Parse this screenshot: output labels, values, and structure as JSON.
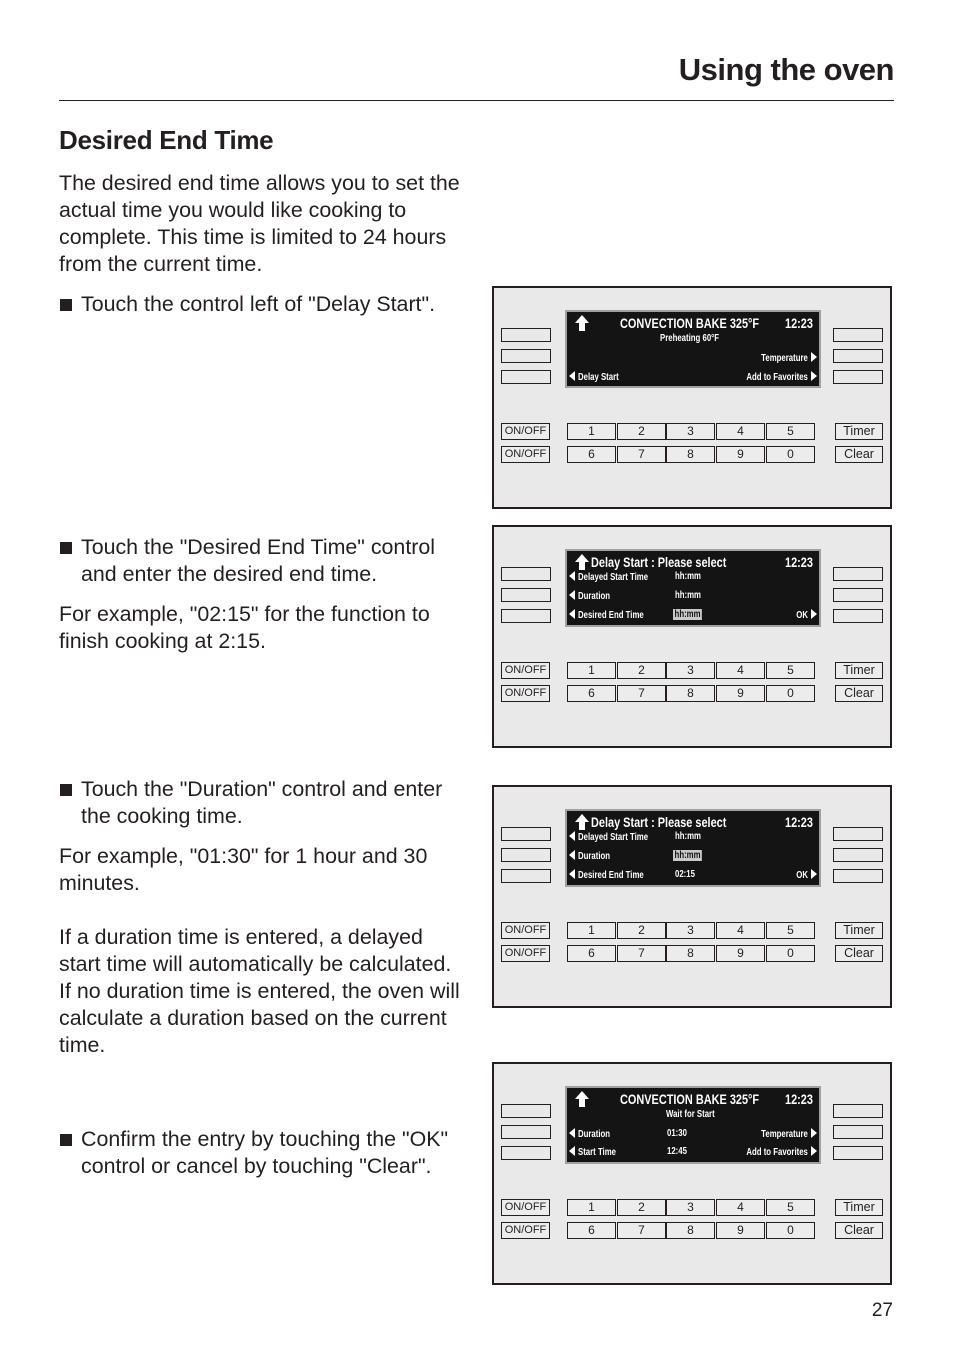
{
  "header": {
    "title": "Using the oven"
  },
  "section": {
    "title": "Desired End Time"
  },
  "intro": "The desired end time allows you to set the actual time you would like cooking to complete. This time is limited to 24 hours from the current time.",
  "steps": [
    {
      "bullet": "Touch the control left of \"Delay Start\"."
    },
    {
      "bullet": "Touch the \"Desired End Time\" control and enter the desired end time.",
      "notes": [
        "For example, \"02:15\" for the function to finish cooking at 2:15."
      ]
    },
    {
      "bullet": "Touch the \"Duration\" control and enter the cooking time.",
      "notes": [
        "For example, \"01:30\" for 1 hour and 30 minutes.",
        "If a duration time is entered, a delayed start time will automatically be calculated.",
        "If no duration time is entered, the oven will calculate a duration based on the current time."
      ]
    },
    {
      "bullet": "Confirm the entry by touching the \"OK\" control or cancel by touching \"Clear\"."
    }
  ],
  "keypad": {
    "onoff": "ON/OFF",
    "row1": [
      "1",
      "2",
      "3",
      "4",
      "5"
    ],
    "row2": [
      "6",
      "7",
      "8",
      "9",
      "0"
    ],
    "timer": "Timer",
    "clear": "Clear"
  },
  "panels": [
    {
      "title": "CONVECTION BAKE 325°F",
      "clock": "12:23",
      "subtitle": "Preheating 60°F",
      "right_items": [
        "Temperature",
        "Add to Favorites"
      ],
      "left_items": [
        "Delay Start"
      ]
    },
    {
      "title": "Delay Start : Please select",
      "clock": "12:23",
      "rows": [
        {
          "label": "Delayed Start Time",
          "value": "hh:mm",
          "highlighted": false
        },
        {
          "label": "Duration",
          "value": "hh:mm",
          "highlighted": false
        },
        {
          "label": "Desired End Time",
          "value": "hh:mm",
          "highlighted": true
        }
      ],
      "ok": "OK"
    },
    {
      "title": "Delay Start : Please select",
      "clock": "12:23",
      "rows": [
        {
          "label": "Delayed Start Time",
          "value": "hh:mm",
          "highlighted": false
        },
        {
          "label": "Duration",
          "value": "hh:mm",
          "highlighted": true
        },
        {
          "label": "Desired End Time",
          "value": "02:15",
          "highlighted": false
        }
      ],
      "ok": "OK"
    },
    {
      "title": "CONVECTION BAKE 325°F",
      "clock": "12:23",
      "subtitle": "Wait for Start",
      "rows": [
        {
          "label": "Duration",
          "value": "01:30",
          "right": "Temperature"
        },
        {
          "label": "Start Time",
          "value": "12:45",
          "right": "Add to Favorites"
        }
      ]
    }
  ],
  "page_number": "27"
}
